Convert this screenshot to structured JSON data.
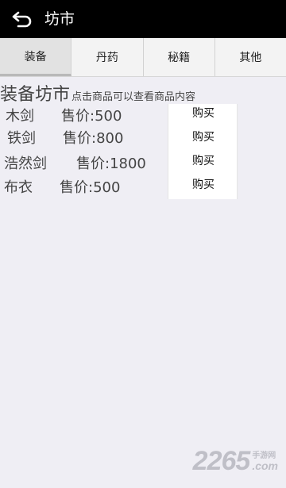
{
  "header": {
    "title": "坊市",
    "back_icon": "back-arrow-icon"
  },
  "tabs": [
    {
      "label": "装备",
      "active": true
    },
    {
      "label": "丹药",
      "active": false
    },
    {
      "label": "秘籍",
      "active": false
    },
    {
      "label": "其他",
      "active": false
    }
  ],
  "section": {
    "heading": "装备坊市",
    "hint": "点击商品可以查看商品内容"
  },
  "items": [
    {
      "name": "木剑",
      "price": "售价:500",
      "buy_label": "购买"
    },
    {
      "name": "铁剑",
      "price": "售价:800",
      "buy_label": "购买"
    },
    {
      "name": "浩然剑",
      "price": "售价:1800",
      "buy_label": "购买"
    },
    {
      "name": "布衣",
      "price": "售价:500",
      "buy_label": "购买"
    }
  ],
  "watermark": {
    "number": "2265",
    "cn": "手游网",
    "com": ".com"
  }
}
